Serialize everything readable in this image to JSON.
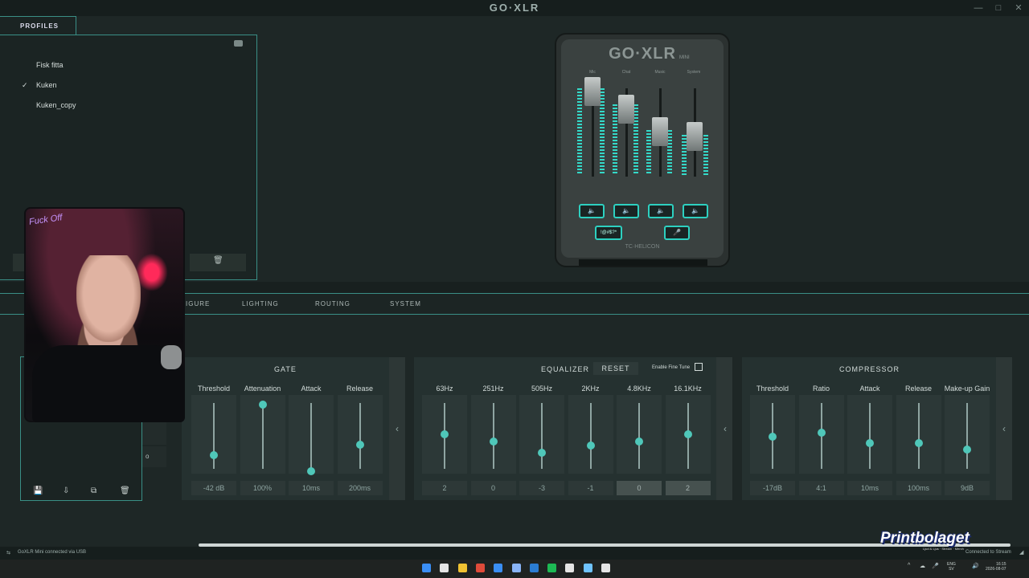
{
  "window": {
    "title": "GO·XLR",
    "minimize": "—",
    "maximize": "□",
    "close": "✕"
  },
  "profiles": {
    "tab_label": "PROFILES",
    "items": [
      {
        "name": "Fisk fitta"
      },
      {
        "name": "Kuken",
        "selected": true
      },
      {
        "name": "Kuken_copy"
      }
    ],
    "check": "✓",
    "delete_icon": "🗑"
  },
  "device": {
    "logo": "GO·XLR",
    "logo_sub": "MINI",
    "channels": [
      "Mic",
      "Chat",
      "Music",
      "System"
    ],
    "mute_icon": "🔈",
    "bleep_label": "!@#$?*",
    "cough_icon": "🎤",
    "brand": "TC·HELICON"
  },
  "tabs": [
    "…IGURE",
    "LIGHTING",
    "ROUTING",
    "SYSTEM"
  ],
  "mic_panel": {
    "side_text": "o",
    "tools": [
      "💾",
      "⇩",
      "⧉",
      "🗑"
    ]
  },
  "gate": {
    "title": "GATE",
    "columns": [
      {
        "label": "Threshold",
        "value": "-42 dB",
        "level": 0.24
      },
      {
        "label": "Attenuation",
        "value": "100%",
        "level": 1.0
      },
      {
        "label": "Attack",
        "value": "10ms",
        "level": 0.0
      },
      {
        "label": "Release",
        "value": "200ms",
        "level": 0.4
      }
    ]
  },
  "equalizer": {
    "title": "EQUALIZER",
    "reset_label": "RESET",
    "fine_tune_label": "Enable Fine Tune",
    "columns": [
      {
        "label": "63Hz",
        "value": "2",
        "level": 0.56
      },
      {
        "label": "251Hz",
        "value": "0",
        "level": 0.45
      },
      {
        "label": "505Hz",
        "value": "-3",
        "level": 0.28
      },
      {
        "label": "2KHz",
        "value": "-1",
        "level": 0.38
      },
      {
        "label": "4.8KHz",
        "value": "0",
        "level": 0.45,
        "highlight": true
      },
      {
        "label": "16.1KHz",
        "value": "2",
        "level": 0.56,
        "highlight": true
      }
    ]
  },
  "compressor": {
    "title": "COMPRESSOR",
    "columns": [
      {
        "label": "Threshold",
        "value": "-17dB",
        "level": 0.52
      },
      {
        "label": "Ratio",
        "value": "4:1",
        "level": 0.58
      },
      {
        "label": "Attack",
        "value": "10ms",
        "level": 0.42
      },
      {
        "label": "Release",
        "value": "100ms",
        "level": 0.42
      },
      {
        "label": "Make-up Gain",
        "value": "9dB",
        "level": 0.32
      }
    ]
  },
  "chevron": "‹",
  "status": {
    "connection": "GoXLR Mini connected via USB",
    "stream": "Connected to Stream",
    "icon": "⇆",
    "resize": "◢"
  },
  "watermark": {
    "text": "Printbolaget",
    "sub": "Ljud & Ljus · Stream · Merch"
  },
  "webcam": {
    "neon_text": "Fuck Off"
  },
  "taskbar": {
    "tray": [
      "^",
      "☁",
      "🎤",
      "🔊"
    ],
    "lang": [
      "ENG",
      "SV"
    ],
    "clock": [
      "16:15",
      "2026-08-07"
    ],
    "icon_colors": [
      "#3a8ef5",
      "#e5e5e5",
      "#f1c232",
      "#e04b3a",
      "#3a8ef5",
      "#8ab4f8",
      "#2b7cd3",
      "#1db954",
      "#e5e5e5",
      "#6fc3ff",
      "#e5e5e5"
    ]
  }
}
